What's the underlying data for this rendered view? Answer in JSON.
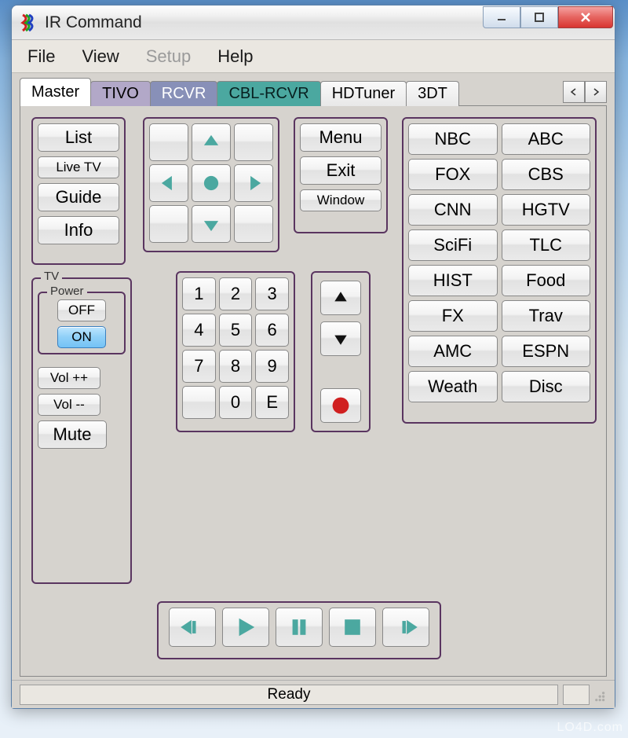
{
  "window": {
    "title": "IR Command"
  },
  "menu": {
    "file": "File",
    "view": "View",
    "setup": "Setup",
    "help": "Help"
  },
  "tabs": {
    "master": "Master",
    "tivo": "TIVO",
    "rcvr": "RCVR",
    "cbl": "CBL-RCVR",
    "hdtuner": "HDTuner",
    "three_d": "3DT"
  },
  "left": {
    "list": "List",
    "live": "Live TV",
    "guide": "Guide",
    "info": "Info"
  },
  "menuSet": {
    "menu": "Menu",
    "exit": "Exit",
    "window": "Window"
  },
  "tv": {
    "label": "TV",
    "power_label": "Power",
    "off": "OFF",
    "on": "ON",
    "vol_up": "Vol ++",
    "vol_down": "Vol --",
    "mute": "Mute"
  },
  "keypad": {
    "1": "1",
    "2": "2",
    "3": "3",
    "4": "4",
    "5": "5",
    "6": "6",
    "7": "7",
    "8": "8",
    "9": "9",
    "blank": "",
    "0": "0",
    "e": "E"
  },
  "channels": {
    "nbc": "NBC",
    "abc": "ABC",
    "fox": "FOX",
    "cbs": "CBS",
    "cnn": "CNN",
    "hgtv": "HGTV",
    "scifi": "SciFi",
    "tlc": "TLC",
    "hist": "HIST",
    "food": "Food",
    "fx": "FX",
    "trav": "Trav",
    "amc": "AMC",
    "espn": "ESPN",
    "weath": "Weath",
    "disc": "Disc"
  },
  "status": {
    "text": "Ready"
  },
  "watermark": "LO4D.com"
}
